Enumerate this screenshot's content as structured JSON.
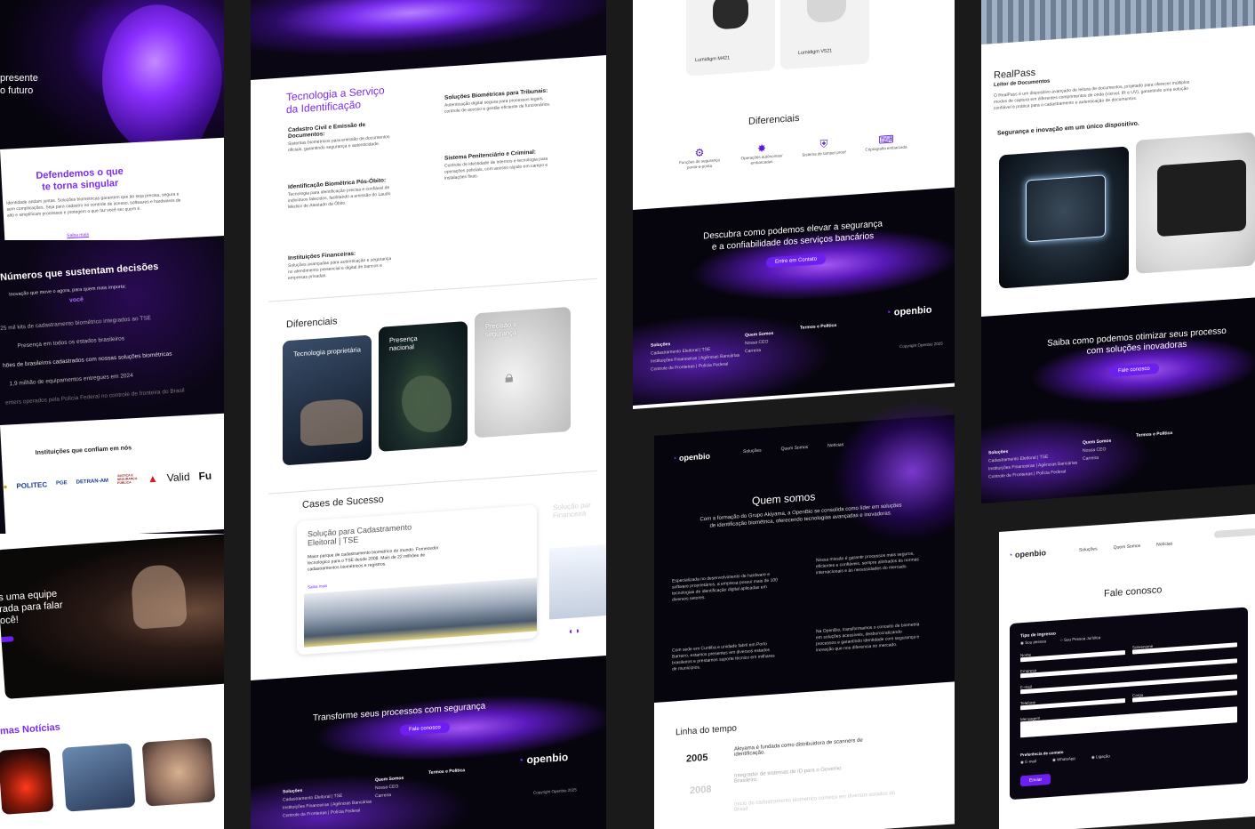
{
  "col1": {
    "hero_line1": "presente",
    "hero_line2": "o futuro",
    "defend_title1": "Defendemos o que",
    "defend_title2": "te torna singular",
    "defend_body": "Identidade andam juntas. Soluções biométricas garantem que ão seja precisa, segura e sem complicações. Seja para cadastro no controle de acesso, softwares e hardwares de alto e simplificam processos e protegem o que faz você ser quem é.",
    "saiba_mais": "Saiba mais",
    "numbers_title": "Números que sustentam decisões",
    "numbers_sub": "Inovação que move o agora, para quem mais importa:",
    "numbers_you": "você",
    "stats": [
      "25 mil kits de cadastramento biométrico integrados ao TSE",
      "Presença em todos os estados brasileiros",
      "hões de brasileiros cadastrados com nossas soluções biométricas",
      "1,9 milhão de equipamentos entregues em 2024",
      "enters operados pela Polícia Federal no controle de fronteira do Brasil"
    ],
    "trust_title": "Instituições que confiam em nós",
    "logos": [
      "POLITEC",
      "PGE",
      "DETRAN-AM",
      "JUSTIÇA E SEGURANÇA PÚBLICA",
      "Valid",
      "Fu"
    ],
    "team_line1": "s uma equipe",
    "team_line2": "rada para falar",
    "team_line3": "ocê!",
    "news_title": "mas Notícias"
  },
  "col2": {
    "tech_title1": "Tecnologia a Serviço",
    "tech_title2": "da Identificação",
    "services": [
      {
        "title": "Cadastro Civil e Emissão de Documentos:",
        "body": "Sistemas biométricos para emissão de documentos oficiais, garantindo segurança e autenticidade."
      },
      {
        "title": "Soluções Biométricas para Tribunais:",
        "body": "Autenticação digital segura para processos legais, controle de acesso e gestão eficiente de funcionários."
      },
      {
        "title": "Identificação Biométrica Pós-Óbito:",
        "body": "Tecnologia para identificação precisa e confiável de indivíduos falecidos, facilitando a emissão do Laudo Médico de Atestado de Óbito."
      },
      {
        "title": "Sistema Penitenciário e Criminal:",
        "body": "Controle de identidade de internos e tecnologia para operações policiais, com acesso rápido em campo e instalações fixas."
      },
      {
        "title": "Instituições Financeiras:",
        "body": "Soluções avançadas para autenticação e segurança no atendimento presencial e digital de bancos e empresas privadas."
      }
    ],
    "diff_title": "Diferenciais",
    "diff_cards": [
      "Tecnologia proprietária",
      "Presença nacional",
      "Precisão e segurança"
    ],
    "cases_title": "Cases de Sucesso",
    "case_title": "Solução para Cadastramento Eleitoral | TSE",
    "case_body": "Maior parque de cadastramento biométrico do mundo. Fornecedor tecnológico para o TSE desde 2008. Mais de 22 milhões de cadastramentos biométricos e registros.",
    "case_link": "Saiba mais",
    "case2_title": "Solução par Financeira",
    "cta_title": "Transforme seus processos com segurança",
    "cta_btn": "Fale conosco",
    "footer_solucoes": "Soluções",
    "footer_items": [
      "Cadastramento Eleitoral | TSE",
      "Instituições Financeiras | Agências Bancárias",
      "Controle de Fronteiras | Polícia Federal"
    ],
    "footer_quem": "Quem Somos",
    "footer_quem_items": [
      "Nossa CEO",
      "Carreira"
    ],
    "footer_termos": "Termos e Política",
    "logo": "openbio",
    "copyright": "Copyright Openbio 2025"
  },
  "col3": {
    "products": [
      "Lumidigm M421",
      "Lumidigm V521"
    ],
    "diff_title": "Diferenciais",
    "features": [
      "Funções de segurança ponta-a-ponta",
      "Operações autônomas/ embarcadas",
      "Sistema de tamper proof",
      "Criptografia embarcada"
    ],
    "cta_title1": "Descubra como podemos elevar a segurança",
    "cta_title2": "e a confiabilidade dos serviços bancários",
    "cta_btn": "Entre em Contato",
    "footer_solucoes": "Soluções",
    "footer_items": [
      "Cadastramento Eleitoral | TSE",
      "Instituições Financeiras | Agências Bancárias",
      "Controle de Fronteiras | Polícia Federal"
    ],
    "footer_quem": "Quem Somos",
    "footer_quem_items": [
      "Nossa CEO",
      "Carreira"
    ],
    "footer_termos": "Termos e Política",
    "logo": "openbio",
    "copyright": "Copyright Openbio 2025",
    "nav": [
      "Soluções",
      "Quem Somos",
      "Notícias"
    ],
    "about_title": "Quem somos",
    "about_body": "Com a formação do Grupo Akiyama, a OpenBio se consolida como líder em soluções de identificação biométrica, oferecendo tecnologias avançadas e inovadoras.",
    "about_blocks": [
      "Especializada no desenvolvimento de hardware e software proprietários, a empresa possui mais de 100 tecnologias de identificação digital aplicadas em diversos setores.",
      "Nossa missão é garantir processos mais seguros, eficientes e confiáveis, sempre alinhados às normas internacionais e às necessidades do mercado.",
      "Com sede em Curitiba e unidade fabril em Porto Barreiro, estamos presentes em diversos estados brasileiros e prestamos suporte técnico em milhares de municípios.",
      "Na OpenBio, transformamos o conceito de biometria em soluções acessíveis, desburocratizando processos e garantindo identidade com segurança e inovação que nos diferencia no mercado."
    ],
    "timeline_title": "Linha do tempo",
    "timeline": [
      {
        "year": "2005",
        "text": "Akiyama é fundada como distribuidora de scanners de identificação."
      },
      {
        "year": "2008",
        "text": "Integrador de sistemas de ID para o Governo Brasileiro."
      },
      {
        "year": "",
        "text": "Início do cadastramento biométrico começa em diversos estados do Brasil"
      }
    ]
  },
  "col4": {
    "product_title": "RealPass",
    "product_sub": "Leitor de Documentos",
    "product_body": "O RealPass é um dispositivo avançado de leitura de documentos, projetado para oferecer múltiplos modos de captura em diferentes comprimentos de onda (visível, IR e UV), garantindo uma solução confiável e prática para o cadastramento e autenticação de documentos.",
    "product_tagline": "Segurança e inovação em um único dispositivo.",
    "cta_title1": "Saiba como podemos otimizar seus processo",
    "cta_title2": "com soluções inovadoras",
    "cta_btn": "Fale conosco",
    "footer_solucoes": "Soluções",
    "footer_items": [
      "Cadastramento Eleitoral | TSE",
      "Instituições Financeiras | Agências Bancárias",
      "Controle de Fronteiras | Polícia Federal"
    ],
    "footer_quem": "Quem Somos",
    "footer_quem_items": [
      "Nossa CEO",
      "Carreira"
    ],
    "footer_termos": "Termos e Política",
    "logo": "openbio",
    "nav": [
      "Soluções",
      "Quem Somos",
      "Notícias"
    ],
    "contact_title": "Fale conosco",
    "form": {
      "tipo_label": "Tipo de Ingresso",
      "tipo_opts": [
        "Sou pessoa",
        "Sou Pessoa Jurídica"
      ],
      "fields": [
        "Nome",
        "Sobrenome",
        "Empresa",
        "E-mail",
        "Telefone",
        "Cargo",
        "Mensagem"
      ],
      "pref_label": "Preferência de contato",
      "pref_opts": [
        "E-mail",
        "WhatsApp",
        "Ligação"
      ],
      "submit": "Enviar"
    }
  },
  "colors": {
    "accent": "#7b2cf0",
    "button": "#6c1ff0",
    "dark": "#06040c"
  }
}
